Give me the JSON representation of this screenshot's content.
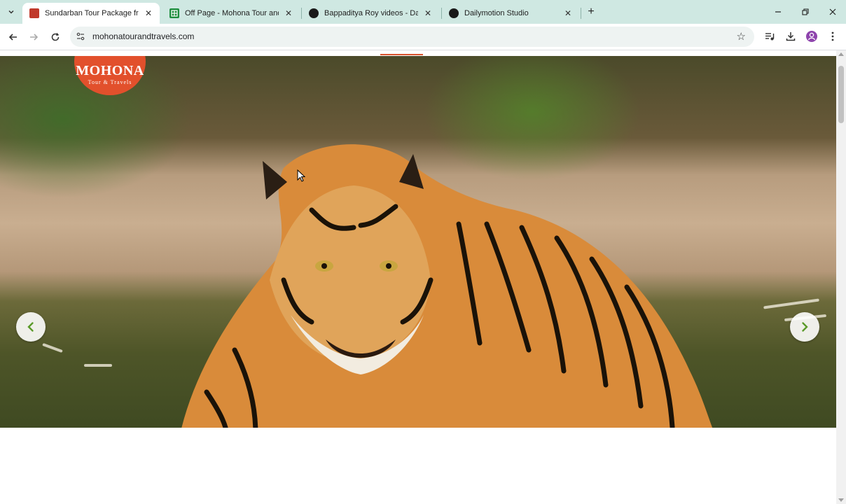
{
  "browser": {
    "tabs": [
      {
        "title": "Sundarban Tour Package from K",
        "active": true,
        "favicon": "mohona-favicon"
      },
      {
        "title": "Off Page - Mohona Tour and Tr",
        "active": false,
        "favicon": "sheets-favicon"
      },
      {
        "title": "Bappaditya Roy videos - Dailym",
        "active": false,
        "favicon": "dailymotion-favicon"
      },
      {
        "title": "Dailymotion Studio",
        "active": false,
        "favicon": "dailymotion-favicon"
      }
    ],
    "url": "mohonatourandtravels.com",
    "colors": {
      "tabstrip": "#cfe8e2",
      "accent": "#e2502c",
      "arrow_green": "#5a9a2a"
    }
  },
  "site": {
    "logo_name": "MOHONA",
    "logo_tagline": "Tour & Travels"
  }
}
